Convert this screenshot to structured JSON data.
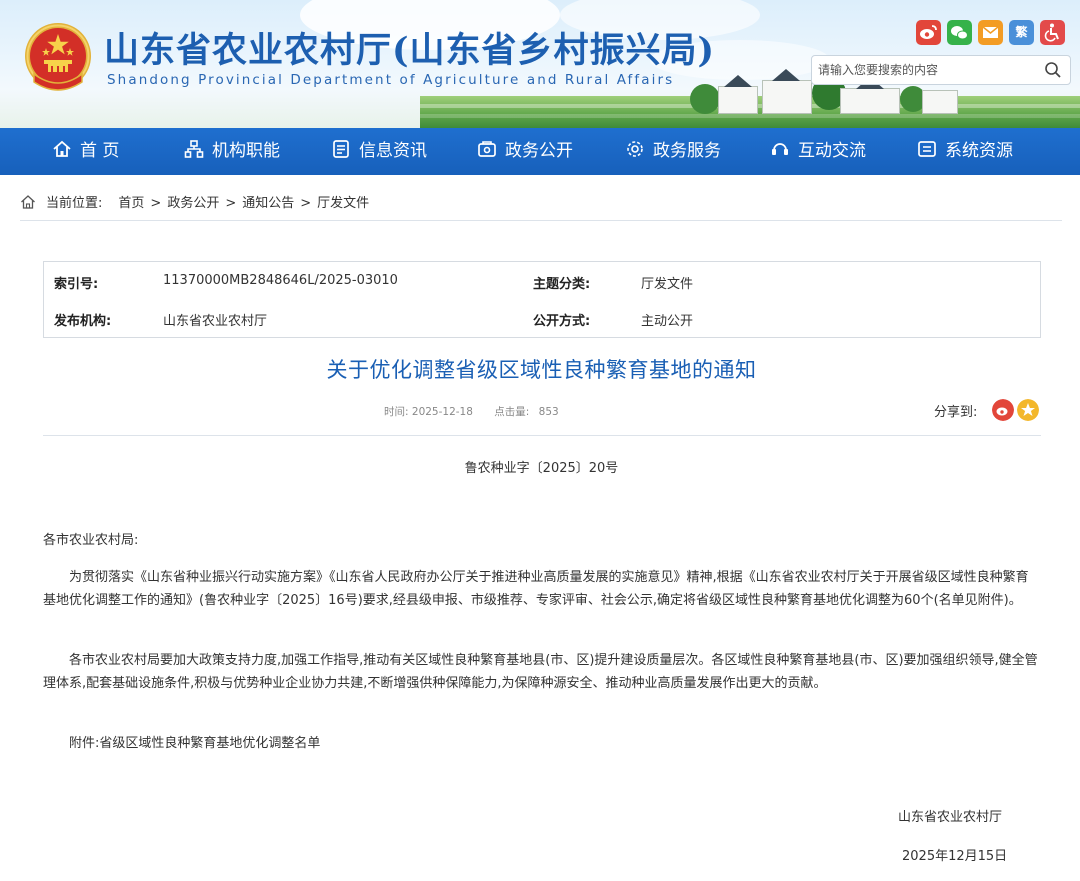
{
  "header": {
    "title": "山东省农业农村厅(山东省乡村振兴局)",
    "subtitle": "Shandong Provincial Department of Agriculture and Rural Affairs",
    "search_placeholder": "请输入您要搜索的内容",
    "social": [
      {
        "name": "weibo-icon",
        "color": "#e2463a"
      },
      {
        "name": "wechat-icon",
        "color": "#36b24a"
      },
      {
        "name": "mail-icon",
        "color": "#f39c24"
      },
      {
        "name": "traditional-chinese",
        "label": "繁",
        "color": "#4a90d9"
      },
      {
        "name": "accessibility-icon",
        "color": "#e34a4a"
      }
    ]
  },
  "nav": {
    "items": [
      {
        "label": "首 页",
        "icon": "home-icon"
      },
      {
        "label": "机构职能",
        "icon": "org-icon"
      },
      {
        "label": "信息资讯",
        "icon": "news-icon"
      },
      {
        "label": "政务公开",
        "icon": "public-icon"
      },
      {
        "label": "政务服务",
        "icon": "service-icon"
      },
      {
        "label": "互动交流",
        "icon": "interact-icon"
      },
      {
        "label": "系统资源",
        "icon": "resource-icon"
      }
    ]
  },
  "breadcrumb": {
    "label": "当前位置:",
    "items": [
      "首页",
      "政务公开",
      "通知公告",
      "厅发文件"
    ],
    "separator": ">"
  },
  "meta": {
    "index_label": "索引号:",
    "index_value": "11370000MB2848646L/2025-03010",
    "topic_label": "主题分类:",
    "topic_value": "厅发文件",
    "publisher_label": "发布机构:",
    "publisher_value": "山东省农业农村厅",
    "method_label": "公开方式:",
    "method_value": "主动公开"
  },
  "article": {
    "title": "关于优化调整省级区域性良种繁育基地的通知",
    "time_label": "时间:",
    "time_value": "2025-12-18",
    "views_label": "点击量:",
    "views_value": "853",
    "share_label": "分享到:",
    "doc_number": "鲁农种业字〔2025〕20号",
    "salutation": "各市农业农村局:",
    "paragraphs": [
      "为贯彻落实《山东省种业振兴行动实施方案》《山东省人民政府办公厅关于推进种业高质量发展的实施意见》精神,根据《山东省农业农村厅关于开展省级区域性良种繁育基地优化调整工作的通知》(鲁农种业字〔2025〕16号)要求,经县级申报、市级推荐、专家评审、社会公示,确定将省级区域性良种繁育基地优化调整为60个(名单见附件)。",
      "各市农业农村局要加大政策支持力度,加强工作指导,推动有关区域性良种繁育基地县(市、区)提升建设质量层次。各区域性良种繁育基地县(市、区)要加强组织领导,健全管理体系,配套基础设施条件,积极与优势种业企业协力共建,不断增强供种保障能力,为保障种源安全、推动种业高质量发展作出更大的贡献。",
      "附件:省级区域性良种繁育基地优化调整名单"
    ],
    "signature": "山东省农业农村厅",
    "date": "2025年12月15日"
  }
}
